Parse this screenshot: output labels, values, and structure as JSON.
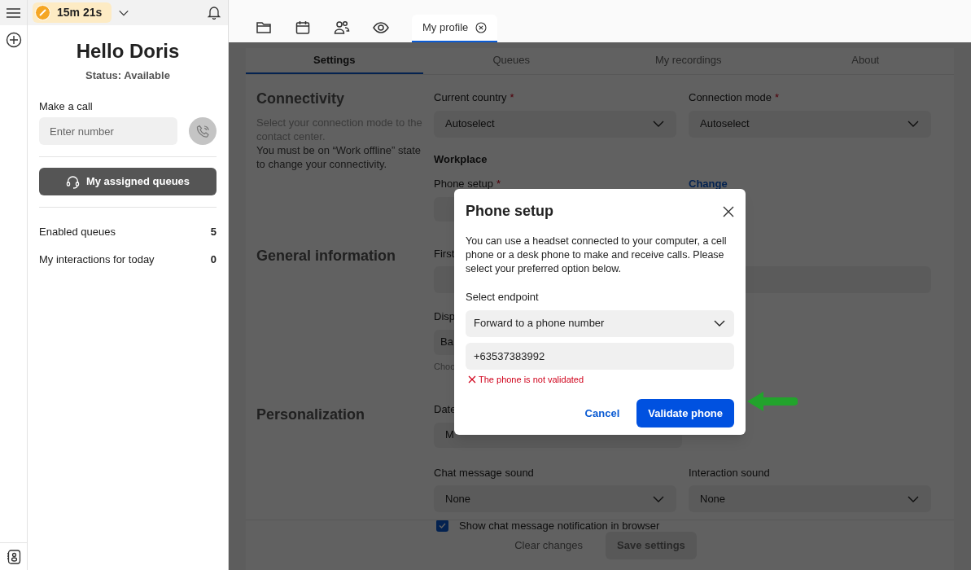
{
  "top_bar": {
    "timer": "15m 21s"
  },
  "sidebar": {
    "greeting": "Hello Doris",
    "status": "Status: Available",
    "call_label": "Make a call",
    "number_placeholder": "Enter number",
    "queues_button": "My assigned queues",
    "stats": [
      {
        "label": "Enabled queues",
        "value": "5"
      },
      {
        "label": "My interactions for today",
        "value": "0"
      }
    ]
  },
  "app_tabs": [
    {
      "kind": "folder",
      "selected": false
    },
    {
      "kind": "calendar",
      "selected": false
    },
    {
      "kind": "people",
      "selected": false
    },
    {
      "kind": "eye",
      "selected": false
    },
    {
      "kind": "label",
      "label": "My profile",
      "selected": true
    }
  ],
  "settings_tabs": [
    {
      "label": "Settings",
      "selected": true
    },
    {
      "label": "Queues",
      "selected": false
    },
    {
      "label": "My recordings",
      "selected": false
    },
    {
      "label": "About",
      "selected": false
    }
  ],
  "connectivity": {
    "title": "Connectivity",
    "hint": "Select your connection mode to the contact center.",
    "note": "You must be on “Work offline” state to change your connectivity.",
    "selects": [
      {
        "label": "Current country",
        "mark": "*",
        "value": "Autoselect"
      },
      {
        "label": "Connection mode",
        "mark": "*",
        "value": "Autoselect"
      }
    ],
    "workplace": "Workplace",
    "phone_setup": {
      "label": "Phone setup",
      "mark": "*",
      "link": "Change"
    }
  },
  "general": {
    "title": "General information",
    "first_label": "First",
    "display_label": "Disp",
    "display_value": "Ba",
    "display_help": "Choo"
  },
  "personalization": {
    "title": "Personalization",
    "date_label": "Date",
    "date_value": "M",
    "selects": [
      {
        "label": "Chat message sound",
        "value": "None"
      },
      {
        "label": "Interaction sound",
        "value": "None"
      }
    ],
    "checkbox": {
      "label": "Show chat message notification in browser",
      "checked": true
    }
  },
  "footer": {
    "clear": "Clear changes",
    "save": "Save settings"
  },
  "dialog": {
    "title": "Phone setup",
    "body": "You can use a headset connected to your computer, a cell phone or a desk phone to make and receive calls. Please select your preferred option below.",
    "endpoint_label": "Select endpoint",
    "endpoint": "Forward to a phone number",
    "phone": "+63537383992",
    "error": "The phone is not validated",
    "cancel": "Cancel",
    "confirm": "Validate phone"
  }
}
